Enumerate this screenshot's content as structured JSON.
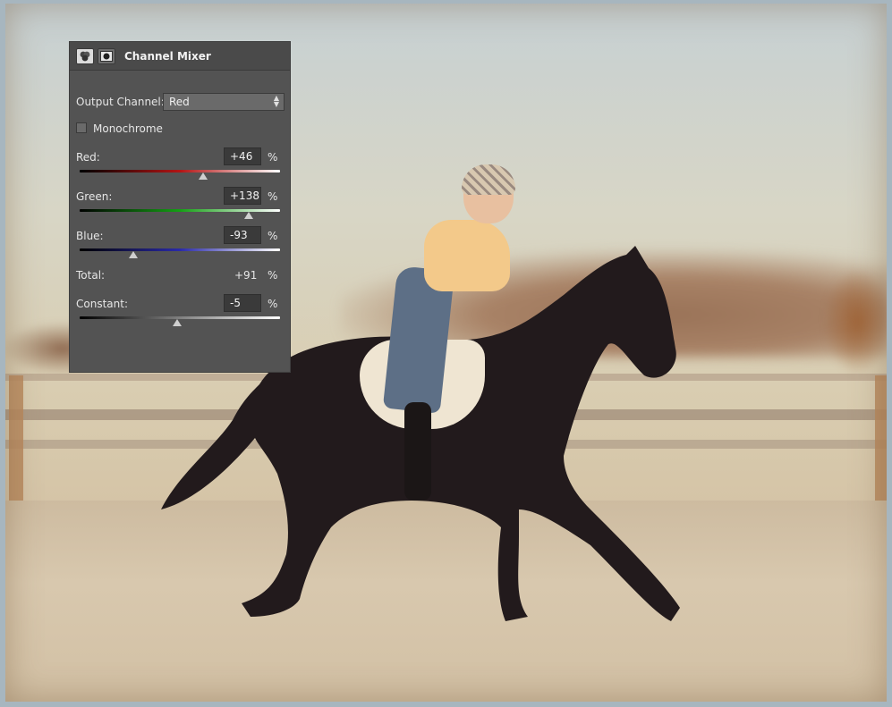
{
  "panel": {
    "title": "Channel Mixer",
    "output_channel": {
      "label": "Output Channel:",
      "value": "Red"
    },
    "monochrome": {
      "label": "Monochrome",
      "checked": false
    },
    "sliders": {
      "red": {
        "label": "Red:",
        "value": "+46",
        "unit": "%",
        "percent": 46
      },
      "green": {
        "label": "Green:",
        "value": "+138",
        "unit": "%",
        "percent": 138
      },
      "blue": {
        "label": "Blue:",
        "value": "-93",
        "unit": "%",
        "percent": -93
      },
      "constant": {
        "label": "Constant:",
        "value": "-5",
        "unit": "%",
        "percent": -5
      }
    },
    "total": {
      "label": "Total:",
      "value": "+91",
      "unit": "%"
    },
    "icons": {
      "adjustment": "channel-mixer-icon",
      "mask": "layer-mask-icon"
    }
  }
}
